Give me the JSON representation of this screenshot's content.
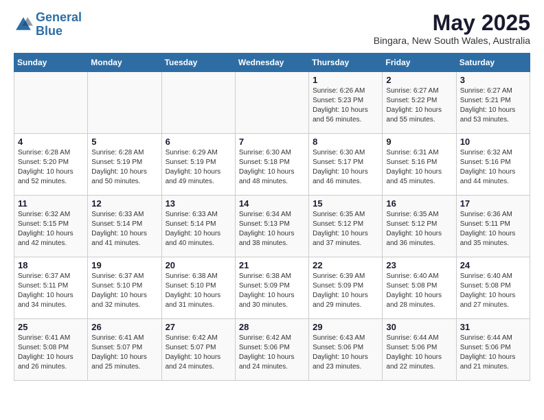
{
  "logo": {
    "line1": "General",
    "line2": "Blue"
  },
  "title": "May 2025",
  "location": "Bingara, New South Wales, Australia",
  "days_of_week": [
    "Sunday",
    "Monday",
    "Tuesday",
    "Wednesday",
    "Thursday",
    "Friday",
    "Saturday"
  ],
  "weeks": [
    [
      {
        "num": "",
        "info": ""
      },
      {
        "num": "",
        "info": ""
      },
      {
        "num": "",
        "info": ""
      },
      {
        "num": "",
        "info": ""
      },
      {
        "num": "1",
        "info": "Sunrise: 6:26 AM\nSunset: 5:23 PM\nDaylight: 10 hours and 56 minutes."
      },
      {
        "num": "2",
        "info": "Sunrise: 6:27 AM\nSunset: 5:22 PM\nDaylight: 10 hours and 55 minutes."
      },
      {
        "num": "3",
        "info": "Sunrise: 6:27 AM\nSunset: 5:21 PM\nDaylight: 10 hours and 53 minutes."
      }
    ],
    [
      {
        "num": "4",
        "info": "Sunrise: 6:28 AM\nSunset: 5:20 PM\nDaylight: 10 hours and 52 minutes."
      },
      {
        "num": "5",
        "info": "Sunrise: 6:28 AM\nSunset: 5:19 PM\nDaylight: 10 hours and 50 minutes."
      },
      {
        "num": "6",
        "info": "Sunrise: 6:29 AM\nSunset: 5:19 PM\nDaylight: 10 hours and 49 minutes."
      },
      {
        "num": "7",
        "info": "Sunrise: 6:30 AM\nSunset: 5:18 PM\nDaylight: 10 hours and 48 minutes."
      },
      {
        "num": "8",
        "info": "Sunrise: 6:30 AM\nSunset: 5:17 PM\nDaylight: 10 hours and 46 minutes."
      },
      {
        "num": "9",
        "info": "Sunrise: 6:31 AM\nSunset: 5:16 PM\nDaylight: 10 hours and 45 minutes."
      },
      {
        "num": "10",
        "info": "Sunrise: 6:32 AM\nSunset: 5:16 PM\nDaylight: 10 hours and 44 minutes."
      }
    ],
    [
      {
        "num": "11",
        "info": "Sunrise: 6:32 AM\nSunset: 5:15 PM\nDaylight: 10 hours and 42 minutes."
      },
      {
        "num": "12",
        "info": "Sunrise: 6:33 AM\nSunset: 5:14 PM\nDaylight: 10 hours and 41 minutes."
      },
      {
        "num": "13",
        "info": "Sunrise: 6:33 AM\nSunset: 5:14 PM\nDaylight: 10 hours and 40 minutes."
      },
      {
        "num": "14",
        "info": "Sunrise: 6:34 AM\nSunset: 5:13 PM\nDaylight: 10 hours and 38 minutes."
      },
      {
        "num": "15",
        "info": "Sunrise: 6:35 AM\nSunset: 5:12 PM\nDaylight: 10 hours and 37 minutes."
      },
      {
        "num": "16",
        "info": "Sunrise: 6:35 AM\nSunset: 5:12 PM\nDaylight: 10 hours and 36 minutes."
      },
      {
        "num": "17",
        "info": "Sunrise: 6:36 AM\nSunset: 5:11 PM\nDaylight: 10 hours and 35 minutes."
      }
    ],
    [
      {
        "num": "18",
        "info": "Sunrise: 6:37 AM\nSunset: 5:11 PM\nDaylight: 10 hours and 34 minutes."
      },
      {
        "num": "19",
        "info": "Sunrise: 6:37 AM\nSunset: 5:10 PM\nDaylight: 10 hours and 32 minutes."
      },
      {
        "num": "20",
        "info": "Sunrise: 6:38 AM\nSunset: 5:10 PM\nDaylight: 10 hours and 31 minutes."
      },
      {
        "num": "21",
        "info": "Sunrise: 6:38 AM\nSunset: 5:09 PM\nDaylight: 10 hours and 30 minutes."
      },
      {
        "num": "22",
        "info": "Sunrise: 6:39 AM\nSunset: 5:09 PM\nDaylight: 10 hours and 29 minutes."
      },
      {
        "num": "23",
        "info": "Sunrise: 6:40 AM\nSunset: 5:08 PM\nDaylight: 10 hours and 28 minutes."
      },
      {
        "num": "24",
        "info": "Sunrise: 6:40 AM\nSunset: 5:08 PM\nDaylight: 10 hours and 27 minutes."
      }
    ],
    [
      {
        "num": "25",
        "info": "Sunrise: 6:41 AM\nSunset: 5:08 PM\nDaylight: 10 hours and 26 minutes."
      },
      {
        "num": "26",
        "info": "Sunrise: 6:41 AM\nSunset: 5:07 PM\nDaylight: 10 hours and 25 minutes."
      },
      {
        "num": "27",
        "info": "Sunrise: 6:42 AM\nSunset: 5:07 PM\nDaylight: 10 hours and 24 minutes."
      },
      {
        "num": "28",
        "info": "Sunrise: 6:42 AM\nSunset: 5:06 PM\nDaylight: 10 hours and 24 minutes."
      },
      {
        "num": "29",
        "info": "Sunrise: 6:43 AM\nSunset: 5:06 PM\nDaylight: 10 hours and 23 minutes."
      },
      {
        "num": "30",
        "info": "Sunrise: 6:44 AM\nSunset: 5:06 PM\nDaylight: 10 hours and 22 minutes."
      },
      {
        "num": "31",
        "info": "Sunrise: 6:44 AM\nSunset: 5:06 PM\nDaylight: 10 hours and 21 minutes."
      }
    ]
  ]
}
